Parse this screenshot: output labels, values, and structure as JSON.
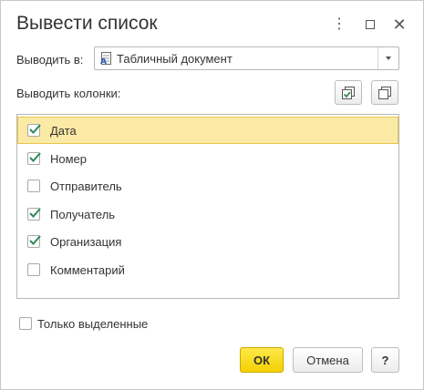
{
  "dialog": {
    "title": "Вывести список",
    "menu_icon": "vertical-dots-icon",
    "maximize_icon": "maximize-icon",
    "close_icon": "close-icon"
  },
  "output": {
    "label": "Выводить в:",
    "value": "Табличный документ",
    "icon": "spreadsheet-document-icon"
  },
  "columns": {
    "label": "Выводить колонки:",
    "check_all_icon": "check-all-icon",
    "uncheck_all_icon": "uncheck-all-icon",
    "items": [
      {
        "label": "Дата",
        "checked": true,
        "selected": true
      },
      {
        "label": "Номер",
        "checked": true,
        "selected": false
      },
      {
        "label": "Отправитель",
        "checked": false,
        "selected": false
      },
      {
        "label": "Получатель",
        "checked": true,
        "selected": false
      },
      {
        "label": "Организация",
        "checked": true,
        "selected": false
      },
      {
        "label": "Комментарий",
        "checked": false,
        "selected": false
      }
    ]
  },
  "only_selected": {
    "label": "Только выделенные",
    "checked": false
  },
  "buttons": {
    "ok": "ОК",
    "cancel": "Отмена",
    "help": "?"
  },
  "colors": {
    "accent": "#f4d000",
    "selection": "#fbe9a6",
    "check": "#2e8b57"
  }
}
